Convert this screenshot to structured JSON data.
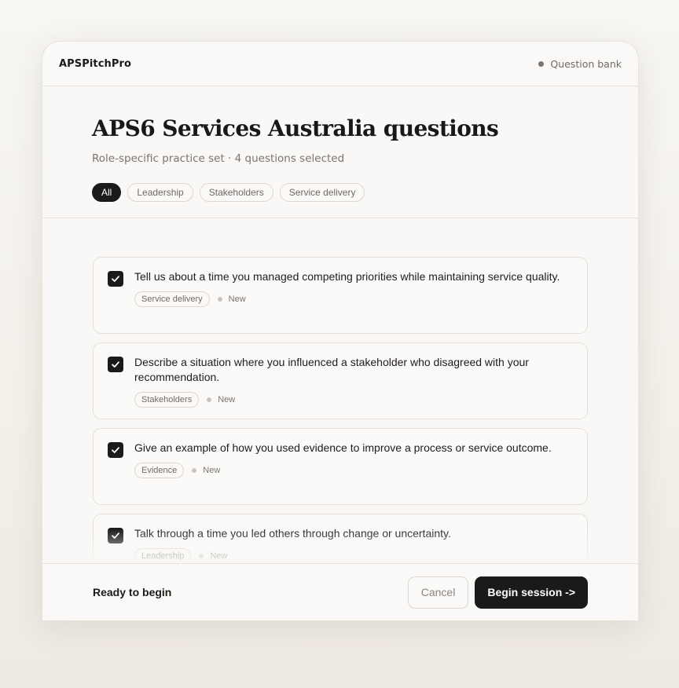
{
  "app": {
    "brand": "APSPitchPro",
    "section": "Question bank"
  },
  "header": {
    "title": "APS6 Services Australia questions",
    "subtitle": "Role-specific practice set · 4 questions selected"
  },
  "filters": [
    {
      "label": "All",
      "active": true
    },
    {
      "label": "Leadership",
      "active": false
    },
    {
      "label": "Stakeholders",
      "active": false
    },
    {
      "label": "Service delivery",
      "active": false
    }
  ],
  "questions": [
    {
      "text": "Tell us about a time you managed competing priorities while maintaining service quality.",
      "tag": "Service delivery",
      "status": "New",
      "checked": true
    },
    {
      "text": "Describe a situation where you influenced a stakeholder who disagreed with your recommendation.",
      "tag": "Stakeholders",
      "status": "New",
      "checked": true
    },
    {
      "text": "Give an example of how you used evidence to improve a process or service outcome.",
      "tag": "Evidence",
      "status": "New",
      "checked": true
    },
    {
      "text": "Talk through a time you led others through change or uncertainty.",
      "tag": "Leadership",
      "status": "New",
      "checked": true
    }
  ],
  "footer": {
    "status": "Ready to begin",
    "cancel_label": "Cancel",
    "begin_label": "Begin session ->"
  },
  "icons": {
    "checkbox": "check-icon",
    "status_dot": "dot-icon"
  },
  "colors": {
    "accent": "#1c1a18",
    "muted": "#7a756f",
    "border": "#e6e2dc"
  }
}
